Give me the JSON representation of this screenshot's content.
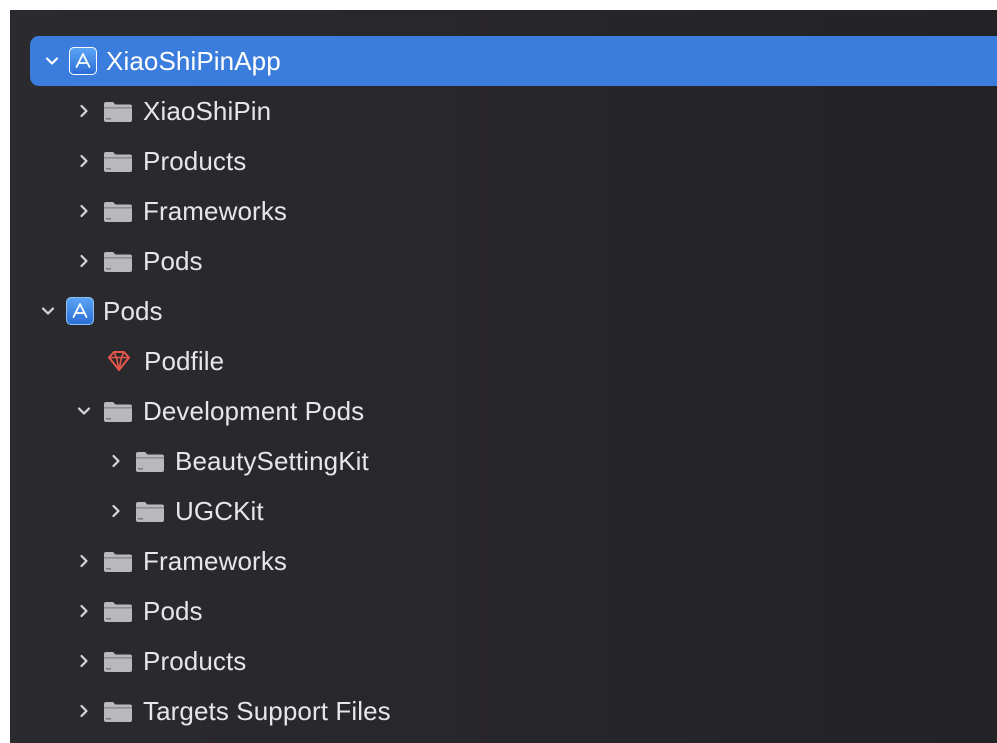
{
  "navigator": {
    "rows": [
      {
        "label": "XiaoShiPinApp",
        "kind": "project",
        "state": "expanded",
        "level": 0,
        "selected": true
      },
      {
        "label": "XiaoShiPin",
        "kind": "folder",
        "state": "collapsed",
        "level": 1
      },
      {
        "label": "Products",
        "kind": "folder",
        "state": "collapsed",
        "level": 1
      },
      {
        "label": "Frameworks",
        "kind": "folder",
        "state": "collapsed",
        "level": 1
      },
      {
        "label": "Pods",
        "kind": "folder",
        "state": "collapsed",
        "level": 1
      },
      {
        "label": "Pods",
        "kind": "project",
        "state": "expanded",
        "level": 0
      },
      {
        "label": "Podfile",
        "kind": "ruby-file",
        "state": "leaf",
        "level": 1
      },
      {
        "label": "Development Pods",
        "kind": "folder",
        "state": "expanded",
        "level": 1
      },
      {
        "label": "BeautySettingKit",
        "kind": "folder",
        "state": "collapsed",
        "level": 2
      },
      {
        "label": "UGCKit",
        "kind": "folder",
        "state": "collapsed",
        "level": 2
      },
      {
        "label": "Frameworks",
        "kind": "folder",
        "state": "collapsed",
        "level": 1
      },
      {
        "label": "Pods",
        "kind": "folder",
        "state": "collapsed",
        "level": 1
      },
      {
        "label": "Products",
        "kind": "folder",
        "state": "collapsed",
        "level": 1
      },
      {
        "label": "Targets Support Files",
        "kind": "folder",
        "state": "collapsed",
        "level": 1
      }
    ]
  },
  "colors": {
    "background": "#27262a",
    "selection": "#3b7ddd",
    "text": "#e6e6e8",
    "folder": "#b9b9bd",
    "ruby": "#e5564a",
    "project_icon": "#3f89ea"
  },
  "icons": {
    "project": "xcode-project-icon",
    "folder": "folder-icon",
    "ruby-file": "ruby-gem-icon",
    "expanded": "chevron-down-icon",
    "collapsed": "chevron-right-icon"
  }
}
